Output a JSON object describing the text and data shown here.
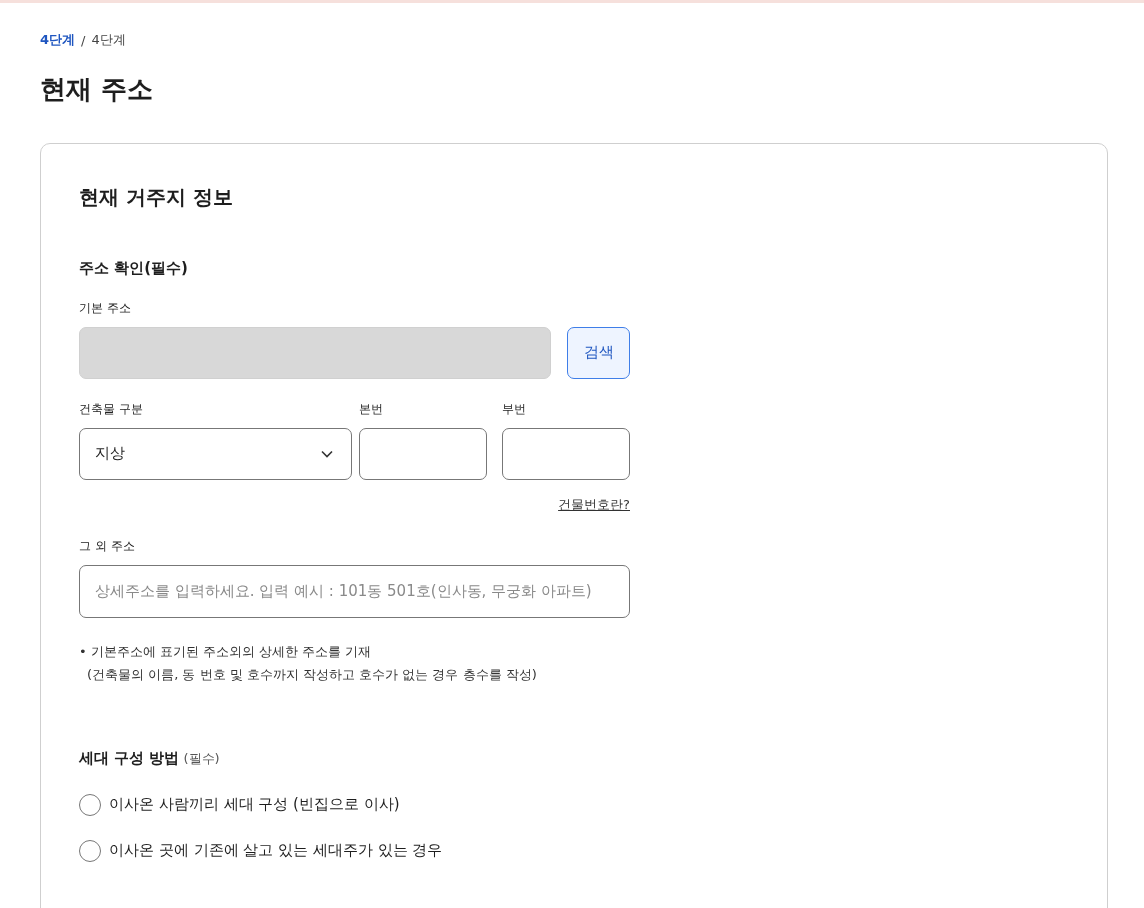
{
  "breadcrumb": {
    "current": "4단계",
    "separator": "/",
    "total": "4단계"
  },
  "page_title": "현재 주소",
  "card": {
    "title": "현재 거주지 정보",
    "address_section": {
      "title": "주소 확인(필수)",
      "basic_address": {
        "label": "기본 주소",
        "disabled": true,
        "search_button": "검색"
      },
      "building_type": {
        "label": "건축물 구분",
        "value": "지상"
      },
      "main_number": {
        "label": "본번"
      },
      "sub_number": {
        "label": "부번"
      },
      "help_link": "건물번호란?",
      "other_address": {
        "label": "그 외 주소",
        "placeholder": "상세주소를 입력하세요. 입력 예시 : 101동 501호(인사동, 무궁화 아파트)"
      },
      "note_lines": [
        "• 기본주소에 표기된 주소외의 상세한 주소를 기재",
        "(건축물의 이름, 동 번호 및 호수까지 작성하고 호수가 없는 경우 층수를 작성)"
      ]
    },
    "household_section": {
      "title": "세대 구성 방법",
      "required": "(필수)",
      "options": [
        {
          "label": "이사온 사람끼리 세대 구성 (빈집으로 이사)",
          "selected": false
        },
        {
          "label": "이사온 곳에 기존에 살고 있는 세대주가 있는 경우",
          "selected": false
        }
      ]
    }
  }
}
